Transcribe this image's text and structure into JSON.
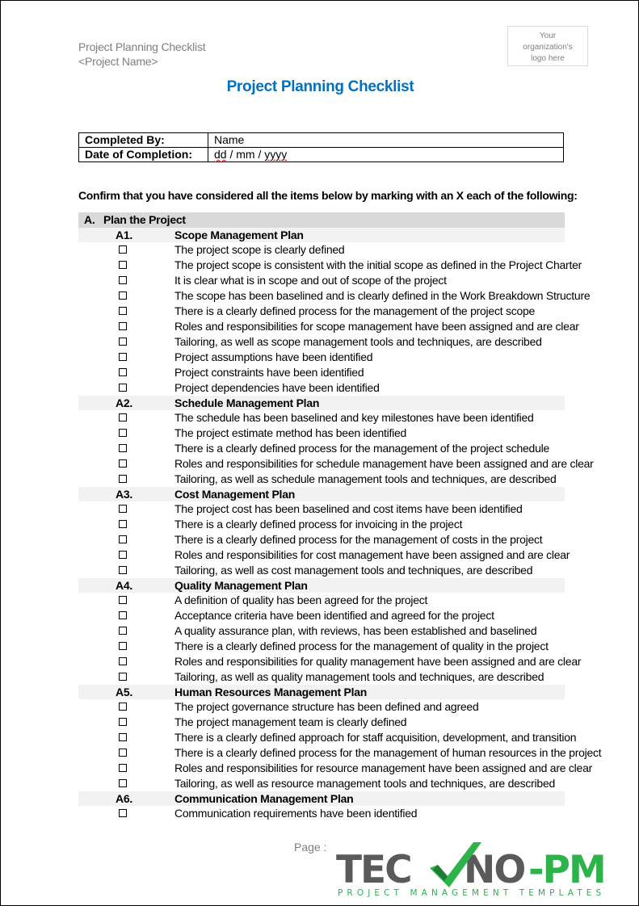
{
  "header": {
    "doc_name": "Project Planning Checklist",
    "project_name": "<Project Name>",
    "logo_placeholder_lines": [
      "Your",
      "organization's",
      "logo here"
    ]
  },
  "title": "Project Planning Checklist",
  "info_table": {
    "completed_by_label": "Completed By:",
    "completed_by_value": "Name",
    "date_label": "Date of Completion:",
    "date_value_dd": "dd",
    "date_value_sep1": " / mm / ",
    "date_value_yyyy": "yyyy"
  },
  "instruction": "Confirm that you have considered all the items below by marking with an X each of the following:",
  "section": {
    "letter": "A.",
    "title": "Plan the Project",
    "subsections": [
      {
        "code": "A1.",
        "title": "Scope Management Plan",
        "items": [
          "The project scope is clearly defined",
          "The project scope is consistent with the initial scope as defined in the Project Charter",
          "It is clear what is in scope and out of scope of the project",
          "The scope has been baselined and is clearly defined in the Work Breakdown Structure",
          "There is a clearly defined process for the management of the project scope",
          "Roles and responsibilities for scope management have been assigned and are clear",
          "Tailoring, as well as scope management tools and techniques, are described",
          "Project assumptions have been identified",
          "Project constraints have been identified",
          "Project dependencies have been identified"
        ]
      },
      {
        "code": "A2.",
        "title": "Schedule Management Plan",
        "items": [
          "The schedule has been baselined and key milestones have been identified",
          "The project estimate method has been identified",
          "There is a clearly defined process for the management of the project schedule",
          "Roles and responsibilities for schedule management have been assigned and are clear",
          "Tailoring, as well as schedule management tools and techniques, are described"
        ]
      },
      {
        "code": "A3.",
        "title": "Cost Management Plan",
        "items": [
          "The project cost has been baselined and cost items have been identified",
          "There is a clearly defined process for invoicing in the project",
          "There is a clearly defined process for the management of costs in the project",
          "Roles and responsibilities for cost management have been assigned and are clear",
          "Tailoring, as well as cost management tools and techniques, are described"
        ]
      },
      {
        "code": "A4.",
        "title": "Quality Management Plan",
        "items": [
          "A definition of quality has been agreed for the project",
          "Acceptance criteria have been identified and agreed for the project",
          "A quality assurance plan, with reviews, has been established and baselined",
          "There is a clearly defined process for the management of quality in the project",
          "Roles and responsibilities for quality management have been assigned and are clear",
          "Tailoring, as well as quality management tools and techniques, are described"
        ]
      },
      {
        "code": "A5.",
        "title": "Human Resources Management Plan",
        "items": [
          "The project governance structure has been defined and agreed",
          "The project management team is clearly defined",
          "There is a clearly defined approach for staff acquisition, development, and transition",
          "There is a clearly defined process for the management of human resources in the project",
          "Roles and responsibilities for resource management have been assigned and are clear",
          "Tailoring, as well as resource management tools and techniques, are described"
        ]
      },
      {
        "code": "A6.",
        "title": "Communication Management Plan",
        "items": [
          "Communication requirements have been identified"
        ]
      }
    ]
  },
  "footer": {
    "page_label": "Page :",
    "brand_left": "TEC",
    "brand_mid": "NO",
    "brand_right": "-PM",
    "brand_tagline": "PROJECT MANAGEMENT TEMPLATES",
    "colors": {
      "brand_gray": "#5a5a5a",
      "brand_green": "#2db34a",
      "title_blue": "#0070c0"
    }
  }
}
